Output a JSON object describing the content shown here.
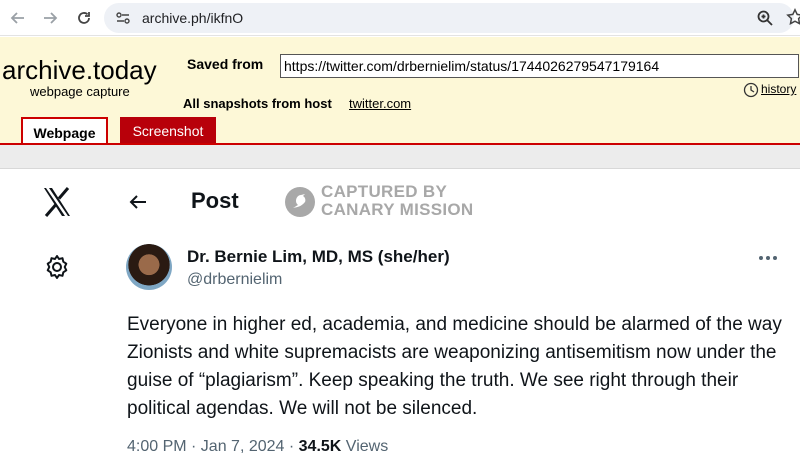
{
  "browser": {
    "url": "archive.ph/ikfnO"
  },
  "archive": {
    "logo": "archive.today",
    "subtitle": "webpage capture",
    "saved_from_label": "Saved from",
    "saved_url": "https://twitter.com/drbernielim/status/1744026279547179164",
    "snapshots_label": "All snapshots  from host",
    "snapshots_host": "twitter.com",
    "history_label": "history",
    "tabs": [
      {
        "label": "Webpage",
        "active": true
      },
      {
        "label": "Screenshot",
        "active": false
      }
    ],
    "accent_color": "#b8000a",
    "header_bg": "#fdf8d7"
  },
  "post": {
    "header_title": "Post",
    "watermark_line1": "CAPTURED BY",
    "watermark_line2": "CANARY MISSION",
    "display_name": "Dr. Bernie Lim, MD, MS (she/her)",
    "handle": "@drbernielim",
    "body": "Everyone in higher ed, academia, and medicine should be alarmed of the way Zionists and white supremacists are weaponizing antisemitism now under the guise of “plagiarism”. Keep speaking the truth. We see right through their political agendas. We will not be silenced.",
    "time": "4:00 PM · Jan 7, 2024 · ",
    "views_count": "34.5K",
    "views_label": " Views"
  }
}
